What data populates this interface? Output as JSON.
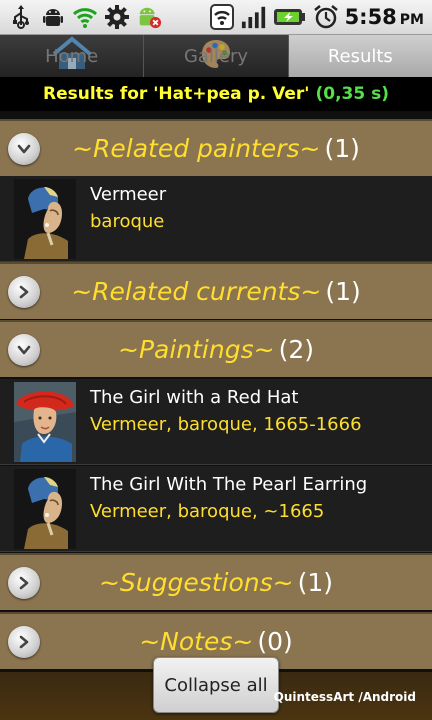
{
  "status_bar": {
    "time": "5:58",
    "ampm": "PM",
    "left_icons": [
      "usb-icon",
      "android-debug-icon",
      "wifi-sync-icon",
      "settings-gear-icon",
      "android-error-icon"
    ],
    "right_icons": [
      "wifi-icon",
      "signal-icon",
      "battery-charging-icon",
      "alarm-icon"
    ]
  },
  "tabs": [
    {
      "label": "Home",
      "icon": "home-icon",
      "active": false
    },
    {
      "label": "Gallery",
      "icon": "palette-icon",
      "active": false
    },
    {
      "label": "Results",
      "icon": "",
      "active": true
    }
  ],
  "results": {
    "query_label": "Results for 'Hat+pea p. Ver'",
    "time": "(0,35 s)"
  },
  "sections": [
    {
      "name": "~Related painters~",
      "count": "(1)",
      "expanded": true,
      "toggle_icon": "chevron-down-icon"
    },
    {
      "name": "~Related currents~",
      "count": "(1)",
      "expanded": false,
      "toggle_icon": "chevron-right-icon"
    },
    {
      "name": "~Paintings~",
      "count": "(2)",
      "expanded": true,
      "toggle_icon": "chevron-down-icon"
    },
    {
      "name": "~Suggestions~",
      "count": "(1)",
      "expanded": false,
      "toggle_icon": "chevron-right-icon"
    },
    {
      "name": "~Notes~",
      "count": "(0)",
      "expanded": false,
      "toggle_icon": "chevron-right-icon"
    }
  ],
  "painters": [
    {
      "name": "Vermeer",
      "style": "baroque",
      "thumb": "pearl-earring-thumbnail"
    }
  ],
  "paintings": [
    {
      "title": "The Girl with a Red Hat",
      "subtitle": "Vermeer, baroque, 1665-1666",
      "thumb": "red-hat-thumbnail"
    },
    {
      "title": "The Girl With The Pearl Earring",
      "subtitle": "Vermeer, baroque, ~1665",
      "thumb": "pearl-earring-thumbnail"
    }
  ],
  "footer": {
    "collapse_label": "Collapse all",
    "brand": "QuintessArt /Android"
  },
  "colors": {
    "section_bg": "#8b7450",
    "accent_yellow": "#ffde2e",
    "time_green": "#55e04a"
  }
}
